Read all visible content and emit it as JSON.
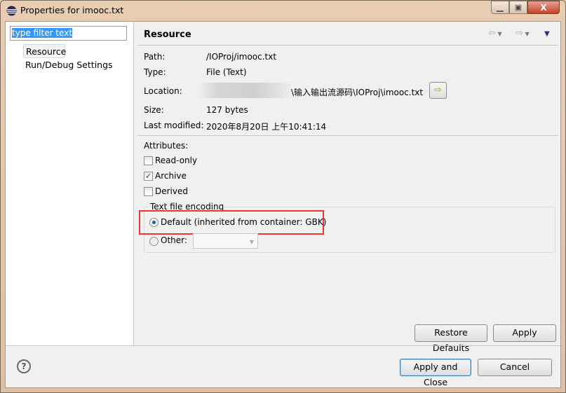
{
  "window": {
    "title": "Properties for imooc.txt"
  },
  "sidebar": {
    "filter_value": "type filter text",
    "items": [
      {
        "label": "Resource"
      },
      {
        "label": "Run/Debug Settings"
      }
    ]
  },
  "page": {
    "title": "Resource",
    "path_label": "Path:",
    "path": "/IOProj/imooc.txt",
    "type_label": "Type:",
    "type": "File  (Text)",
    "location_label": "Location:",
    "location": "\\输入输出流源码\\IOProj\\imooc.txt",
    "size_label": "Size:",
    "size": "127  bytes",
    "modified_label": "Last modified:",
    "modified": "2020年8月20日 上午10:41:14",
    "attributes_label": "Attributes:",
    "attributes": [
      {
        "label": "Read-only",
        "checked": false
      },
      {
        "label": "Archive",
        "checked": true
      },
      {
        "label": "Derived",
        "checked": false
      }
    ],
    "encoding_label": "Text file encoding",
    "default_encoding": "Default (inherited from container: GBK)",
    "other_label": "Other:",
    "highlight_color": "#ee3333"
  },
  "buttons": {
    "restore": "Restore Defaults",
    "apply": "Apply",
    "apply_close": "Apply and Close",
    "cancel": "Cancel"
  }
}
